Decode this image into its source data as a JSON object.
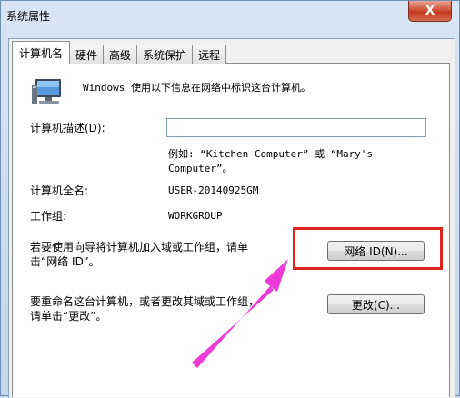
{
  "window": {
    "title": "系统属性",
    "close_glyph": "X"
  },
  "tabs": [
    {
      "label": "计算机名",
      "active": true
    },
    {
      "label": "硬件"
    },
    {
      "label": "高级"
    },
    {
      "label": "系统保护"
    },
    {
      "label": "远程"
    }
  ],
  "info_text": "Windows 使用以下信息在网络中标识这台计算机。",
  "description": {
    "label": "计算机描述(D):",
    "value": "",
    "example_line1": "例如: “Kitchen Computer” 或 “Mary's",
    "example_line2": "Computer”。"
  },
  "full_name": {
    "label": "计算机全名:",
    "value": "USER-20140925GM"
  },
  "workgroup": {
    "label": "工作组:",
    "value": "WORKGROUP"
  },
  "network_section": {
    "text_line1": "若要使用向导将计算机加入域或工作组，请单",
    "text_line2": "击“网络 ID”。",
    "button_label": "网络 ID(N)..."
  },
  "rename_section": {
    "text_line1": "要重命名这台计算机，或者更改其域或工作组，",
    "text_line2": "请单击“更改”。",
    "button_label": "更改(C)..."
  },
  "colors": {
    "highlight_box": "#e0231f",
    "arrow": "#ee3bd8",
    "close_button": "#c23a1f"
  }
}
